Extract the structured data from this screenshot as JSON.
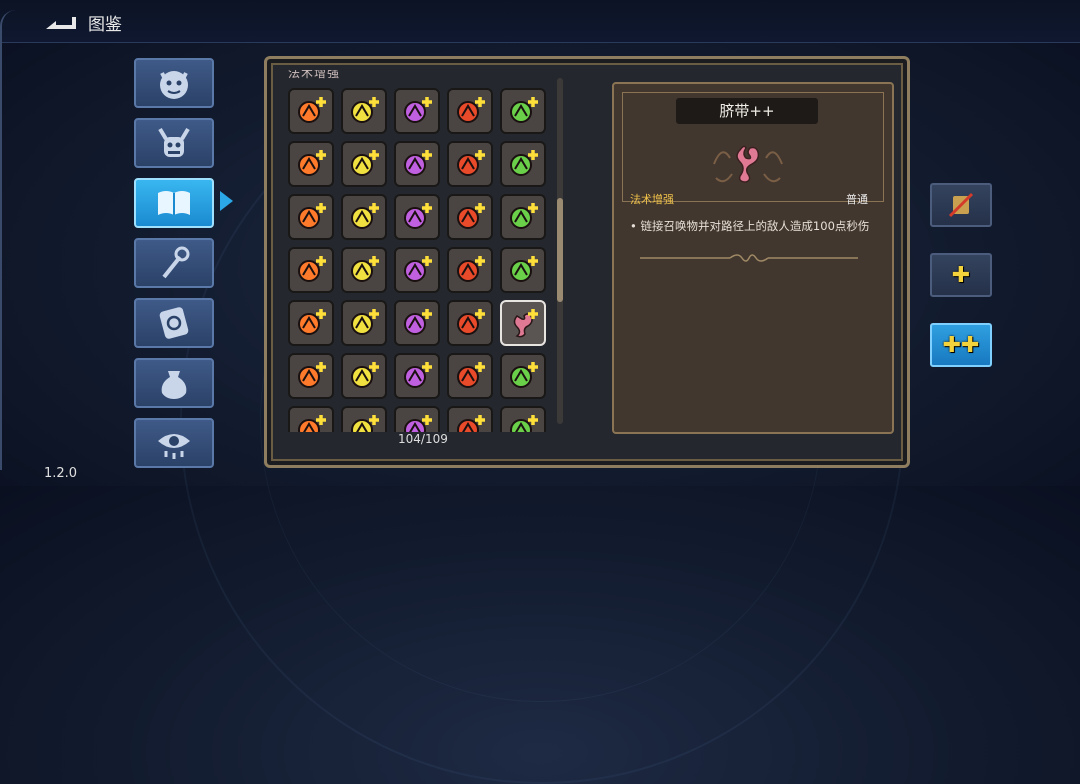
{
  "header": {
    "title": "图鉴"
  },
  "version": "1.2.0",
  "categories": [
    {
      "icon": "demon-face-icon",
      "active": false
    },
    {
      "icon": "horned-skull-icon",
      "active": false
    },
    {
      "icon": "book-icon",
      "active": true
    },
    {
      "icon": "staff-icon",
      "active": false
    },
    {
      "icon": "spell-card-icon",
      "active": false
    },
    {
      "icon": "pouch-icon",
      "active": false
    },
    {
      "icon": "eye-icon",
      "active": false
    }
  ],
  "grid": {
    "section_title": "法术增强",
    "count": "104/109",
    "items": [
      "triple-arrow-icon",
      "claw-slash-icon",
      "fire-burst-icon",
      "golden-orb-icon",
      "green-gem-icon",
      "target-arrow-icon",
      "lightning-chain-icon",
      "pause-icon",
      "crescent-icon",
      "mouse-icon",
      "crosshair-icon",
      "trend-up-icon",
      "split-arrow-icon",
      "blue-crystal-icon",
      "larva-icon",
      "thunder-hand-icon",
      "rising-arrows-icon",
      "compass-icon",
      "battery-icon",
      "grid-frame-icon",
      "chevron-chain-icon",
      "sun-flare-icon",
      "potion-icon",
      "cube-icon",
      "umbilical-icon",
      "flower-burst-icon",
      "swirl-claw-icon",
      "wheel-icon",
      "hook-icon",
      "vortex-icon",
      "bars-icon",
      "beetle-icon",
      "flame-burst-icon",
      "spikes-icon",
      "hex-icon"
    ],
    "selected_index": 24
  },
  "detail": {
    "name": "脐带++",
    "icon": "umbilical-icon",
    "category": "法术增强",
    "rarity": "普通",
    "description": "• 链接召唤物并对路径上的敌人造成100点秒伤"
  },
  "side_buttons": [
    {
      "label": "",
      "icon": "slashed-card-icon",
      "active": false
    },
    {
      "label": "✚",
      "active": false
    },
    {
      "label": "✚✚",
      "active": true
    }
  ],
  "colors": {
    "accent": "#2aa8e8",
    "rarity": "#f0c24a",
    "panel_border": "#8e7d5e"
  }
}
